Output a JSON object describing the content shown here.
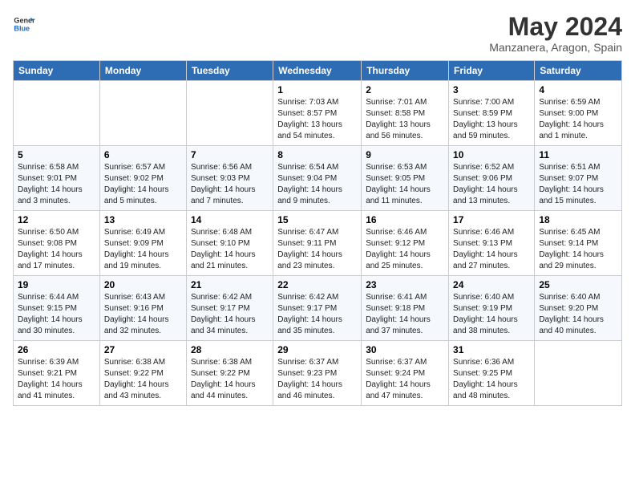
{
  "header": {
    "logo_general": "General",
    "logo_blue": "Blue",
    "month_year": "May 2024",
    "location": "Manzanera, Aragon, Spain"
  },
  "weekdays": [
    "Sunday",
    "Monday",
    "Tuesday",
    "Wednesday",
    "Thursday",
    "Friday",
    "Saturday"
  ],
  "weeks": [
    [
      {
        "day": "",
        "detail": ""
      },
      {
        "day": "",
        "detail": ""
      },
      {
        "day": "",
        "detail": ""
      },
      {
        "day": "1",
        "detail": "Sunrise: 7:03 AM\nSunset: 8:57 PM\nDaylight: 13 hours and 54 minutes."
      },
      {
        "day": "2",
        "detail": "Sunrise: 7:01 AM\nSunset: 8:58 PM\nDaylight: 13 hours and 56 minutes."
      },
      {
        "day": "3",
        "detail": "Sunrise: 7:00 AM\nSunset: 8:59 PM\nDaylight: 13 hours and 59 minutes."
      },
      {
        "day": "4",
        "detail": "Sunrise: 6:59 AM\nSunset: 9:00 PM\nDaylight: 14 hours and 1 minute."
      }
    ],
    [
      {
        "day": "5",
        "detail": "Sunrise: 6:58 AM\nSunset: 9:01 PM\nDaylight: 14 hours and 3 minutes."
      },
      {
        "day": "6",
        "detail": "Sunrise: 6:57 AM\nSunset: 9:02 PM\nDaylight: 14 hours and 5 minutes."
      },
      {
        "day": "7",
        "detail": "Sunrise: 6:56 AM\nSunset: 9:03 PM\nDaylight: 14 hours and 7 minutes."
      },
      {
        "day": "8",
        "detail": "Sunrise: 6:54 AM\nSunset: 9:04 PM\nDaylight: 14 hours and 9 minutes."
      },
      {
        "day": "9",
        "detail": "Sunrise: 6:53 AM\nSunset: 9:05 PM\nDaylight: 14 hours and 11 minutes."
      },
      {
        "day": "10",
        "detail": "Sunrise: 6:52 AM\nSunset: 9:06 PM\nDaylight: 14 hours and 13 minutes."
      },
      {
        "day": "11",
        "detail": "Sunrise: 6:51 AM\nSunset: 9:07 PM\nDaylight: 14 hours and 15 minutes."
      }
    ],
    [
      {
        "day": "12",
        "detail": "Sunrise: 6:50 AM\nSunset: 9:08 PM\nDaylight: 14 hours and 17 minutes."
      },
      {
        "day": "13",
        "detail": "Sunrise: 6:49 AM\nSunset: 9:09 PM\nDaylight: 14 hours and 19 minutes."
      },
      {
        "day": "14",
        "detail": "Sunrise: 6:48 AM\nSunset: 9:10 PM\nDaylight: 14 hours and 21 minutes."
      },
      {
        "day": "15",
        "detail": "Sunrise: 6:47 AM\nSunset: 9:11 PM\nDaylight: 14 hours and 23 minutes."
      },
      {
        "day": "16",
        "detail": "Sunrise: 6:46 AM\nSunset: 9:12 PM\nDaylight: 14 hours and 25 minutes."
      },
      {
        "day": "17",
        "detail": "Sunrise: 6:46 AM\nSunset: 9:13 PM\nDaylight: 14 hours and 27 minutes."
      },
      {
        "day": "18",
        "detail": "Sunrise: 6:45 AM\nSunset: 9:14 PM\nDaylight: 14 hours and 29 minutes."
      }
    ],
    [
      {
        "day": "19",
        "detail": "Sunrise: 6:44 AM\nSunset: 9:15 PM\nDaylight: 14 hours and 30 minutes."
      },
      {
        "day": "20",
        "detail": "Sunrise: 6:43 AM\nSunset: 9:16 PM\nDaylight: 14 hours and 32 minutes."
      },
      {
        "day": "21",
        "detail": "Sunrise: 6:42 AM\nSunset: 9:17 PM\nDaylight: 14 hours and 34 minutes."
      },
      {
        "day": "22",
        "detail": "Sunrise: 6:42 AM\nSunset: 9:17 PM\nDaylight: 14 hours and 35 minutes."
      },
      {
        "day": "23",
        "detail": "Sunrise: 6:41 AM\nSunset: 9:18 PM\nDaylight: 14 hours and 37 minutes."
      },
      {
        "day": "24",
        "detail": "Sunrise: 6:40 AM\nSunset: 9:19 PM\nDaylight: 14 hours and 38 minutes."
      },
      {
        "day": "25",
        "detail": "Sunrise: 6:40 AM\nSunset: 9:20 PM\nDaylight: 14 hours and 40 minutes."
      }
    ],
    [
      {
        "day": "26",
        "detail": "Sunrise: 6:39 AM\nSunset: 9:21 PM\nDaylight: 14 hours and 41 minutes."
      },
      {
        "day": "27",
        "detail": "Sunrise: 6:38 AM\nSunset: 9:22 PM\nDaylight: 14 hours and 43 minutes."
      },
      {
        "day": "28",
        "detail": "Sunrise: 6:38 AM\nSunset: 9:22 PM\nDaylight: 14 hours and 44 minutes."
      },
      {
        "day": "29",
        "detail": "Sunrise: 6:37 AM\nSunset: 9:23 PM\nDaylight: 14 hours and 46 minutes."
      },
      {
        "day": "30",
        "detail": "Sunrise: 6:37 AM\nSunset: 9:24 PM\nDaylight: 14 hours and 47 minutes."
      },
      {
        "day": "31",
        "detail": "Sunrise: 6:36 AM\nSunset: 9:25 PM\nDaylight: 14 hours and 48 minutes."
      },
      {
        "day": "",
        "detail": ""
      }
    ]
  ]
}
